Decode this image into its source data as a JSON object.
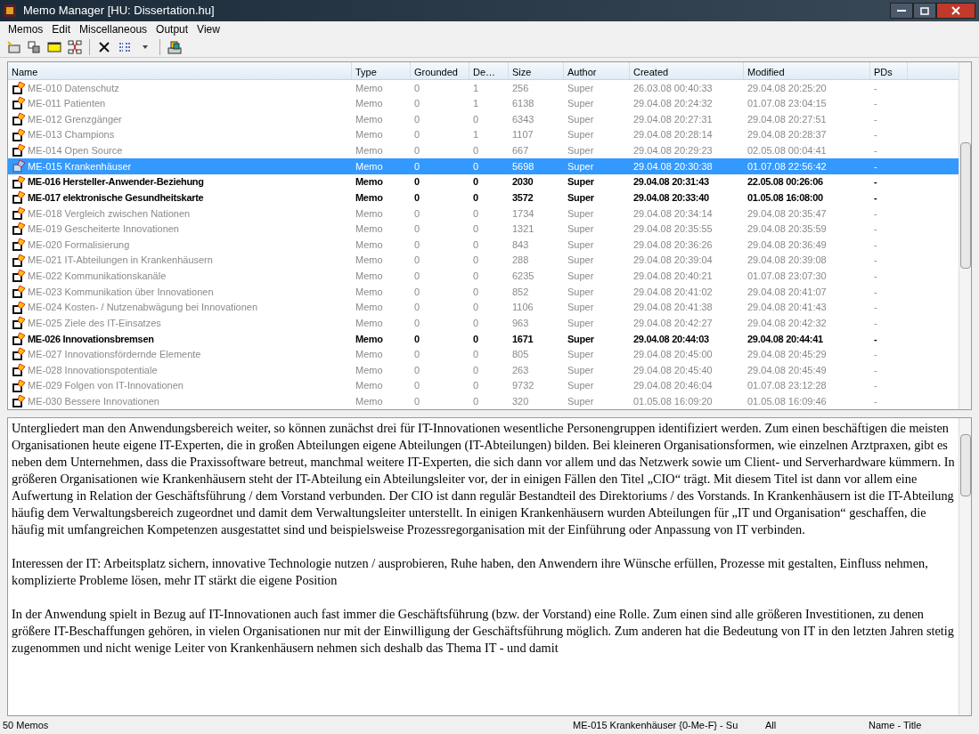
{
  "window": {
    "title": "Memo Manager [HU: Dissertation.hu]"
  },
  "menu": [
    "Memos",
    "Edit",
    "Miscellaneous",
    "Output",
    "View"
  ],
  "table": {
    "columns": [
      "Name",
      "Type",
      "Grounded",
      "De…",
      "Size",
      "Author",
      "Created",
      "Modified",
      "PDs"
    ],
    "rows": [
      {
        "name": "ME-010 Datenschutz",
        "type": "Memo",
        "grounded": "0",
        "de": "1",
        "size": "256",
        "author": "Super",
        "created": "26.03.08 00:40:33",
        "modified": "29.04.08 20:25:20",
        "pds": "-",
        "selected": false,
        "highlighted": false
      },
      {
        "name": "ME-011 Patienten",
        "type": "Memo",
        "grounded": "0",
        "de": "1",
        "size": "6138",
        "author": "Super",
        "created": "29.04.08 20:24:32",
        "modified": "01.07.08 23:04:15",
        "pds": "-",
        "selected": false,
        "highlighted": false
      },
      {
        "name": "ME-012 Grenzgänger",
        "type": "Memo",
        "grounded": "0",
        "de": "0",
        "size": "6343",
        "author": "Super",
        "created": "29.04.08 20:27:31",
        "modified": "29.04.08 20:27:51",
        "pds": "-",
        "selected": false,
        "highlighted": false
      },
      {
        "name": "ME-013 Champions",
        "type": "Memo",
        "grounded": "0",
        "de": "1",
        "size": "1107",
        "author": "Super",
        "created": "29.04.08 20:28:14",
        "modified": "29.04.08 20:28:37",
        "pds": "-",
        "selected": false,
        "highlighted": false
      },
      {
        "name": "ME-014 Open Source",
        "type": "Memo",
        "grounded": "0",
        "de": "0",
        "size": "667",
        "author": "Super",
        "created": "29.04.08 20:29:23",
        "modified": "02.05.08 00:04:41",
        "pds": "-",
        "selected": false,
        "highlighted": false
      },
      {
        "name": "ME-015 Krankenhäuser",
        "type": "Memo",
        "grounded": "0",
        "de": "0",
        "size": "5698",
        "author": "Super",
        "created": "29.04.08 20:30:38",
        "modified": "01.07.08 22:56:42",
        "pds": "-",
        "selected": true,
        "highlighted": false
      },
      {
        "name": "ME-016 Hersteller-Anwender-Beziehung",
        "type": "Memo",
        "grounded": "0",
        "de": "0",
        "size": "2030",
        "author": "Super",
        "created": "29.04.08 20:31:43",
        "modified": "22.05.08 00:26:06",
        "pds": "-",
        "selected": false,
        "highlighted": true
      },
      {
        "name": "ME-017 elektronische Gesundheitskarte",
        "type": "Memo",
        "grounded": "0",
        "de": "0",
        "size": "3572",
        "author": "Super",
        "created": "29.04.08 20:33:40",
        "modified": "01.05.08 16:08:00",
        "pds": "-",
        "selected": false,
        "highlighted": true
      },
      {
        "name": "ME-018 Vergleich zwischen Nationen",
        "type": "Memo",
        "grounded": "0",
        "de": "0",
        "size": "1734",
        "author": "Super",
        "created": "29.04.08 20:34:14",
        "modified": "29.04.08 20:35:47",
        "pds": "-",
        "selected": false,
        "highlighted": false
      },
      {
        "name": "ME-019 Gescheiterte Innovationen",
        "type": "Memo",
        "grounded": "0",
        "de": "0",
        "size": "1321",
        "author": "Super",
        "created": "29.04.08 20:35:55",
        "modified": "29.04.08 20:35:59",
        "pds": "-",
        "selected": false,
        "highlighted": false
      },
      {
        "name": "ME-020 Formalisierung",
        "type": "Memo",
        "grounded": "0",
        "de": "0",
        "size": "843",
        "author": "Super",
        "created": "29.04.08 20:36:26",
        "modified": "29.04.08 20:36:49",
        "pds": "-",
        "selected": false,
        "highlighted": false
      },
      {
        "name": "ME-021 IT-Abteilungen in Krankenhäusern",
        "type": "Memo",
        "grounded": "0",
        "de": "0",
        "size": "288",
        "author": "Super",
        "created": "29.04.08 20:39:04",
        "modified": "29.04.08 20:39:08",
        "pds": "-",
        "selected": false,
        "highlighted": false
      },
      {
        "name": "ME-022 Kommunikationskanäle",
        "type": "Memo",
        "grounded": "0",
        "de": "0",
        "size": "6235",
        "author": "Super",
        "created": "29.04.08 20:40:21",
        "modified": "01.07.08 23:07:30",
        "pds": "-",
        "selected": false,
        "highlighted": false
      },
      {
        "name": "ME-023 Kommunikation über Innovationen",
        "type": "Memo",
        "grounded": "0",
        "de": "0",
        "size": "852",
        "author": "Super",
        "created": "29.04.08 20:41:02",
        "modified": "29.04.08 20:41:07",
        "pds": "-",
        "selected": false,
        "highlighted": false
      },
      {
        "name": "ME-024 Kosten- / Nutzenabwägung bei Innovationen",
        "type": "Memo",
        "grounded": "0",
        "de": "0",
        "size": "1106",
        "author": "Super",
        "created": "29.04.08 20:41:38",
        "modified": "29.04.08 20:41:43",
        "pds": "-",
        "selected": false,
        "highlighted": false
      },
      {
        "name": "ME-025 Ziele des IT-Einsatzes",
        "type": "Memo",
        "grounded": "0",
        "de": "0",
        "size": "963",
        "author": "Super",
        "created": "29.04.08 20:42:27",
        "modified": "29.04.08 20:42:32",
        "pds": "-",
        "selected": false,
        "highlighted": false
      },
      {
        "name": "ME-026 Innovationsbremsen",
        "type": "Memo",
        "grounded": "0",
        "de": "0",
        "size": "1671",
        "author": "Super",
        "created": "29.04.08 20:44:03",
        "modified": "29.04.08 20:44:41",
        "pds": "-",
        "selected": false,
        "highlighted": true
      },
      {
        "name": "ME-027 Innovationsfördernde Elemente",
        "type": "Memo",
        "grounded": "0",
        "de": "0",
        "size": "805",
        "author": "Super",
        "created": "29.04.08 20:45:00",
        "modified": "29.04.08 20:45:29",
        "pds": "-",
        "selected": false,
        "highlighted": false
      },
      {
        "name": "ME-028 Innovationspotentiale",
        "type": "Memo",
        "grounded": "0",
        "de": "0",
        "size": "263",
        "author": "Super",
        "created": "29.04.08 20:45:40",
        "modified": "29.04.08 20:45:49",
        "pds": "-",
        "selected": false,
        "highlighted": false
      },
      {
        "name": "ME-029 Folgen von IT-Innovationen",
        "type": "Memo",
        "grounded": "0",
        "de": "0",
        "size": "9732",
        "author": "Super",
        "created": "29.04.08 20:46:04",
        "modified": "01.07.08 23:12:28",
        "pds": "-",
        "selected": false,
        "highlighted": false
      },
      {
        "name": "ME-030 Bessere Innovationen",
        "type": "Memo",
        "grounded": "0",
        "de": "0",
        "size": "320",
        "author": "Super",
        "created": "01.05.08 16:09:20",
        "modified": "01.05.08 16:09:46",
        "pds": "-",
        "selected": false,
        "highlighted": false
      }
    ]
  },
  "memo_text": [
    "Untergliedert man den Anwendungsbereich weiter, so können zunächst drei für IT-Innovationen wesentliche Personengruppen identifiziert werden. Zum einen beschäftigen die meisten Organisationen heute eigene IT-Experten, die in großen Abteilungen eigene Abteilungen (IT-Abteilungen) bilden. Bei kleineren Organisationsformen, wie einzelnen Arztpraxen, gibt es neben dem Unternehmen, dass die Praxissoftware betreut, manchmal weitere IT-Experten, die sich dann vor allem und das Netzwerk sowie um Client- und Serverhardware kümmern. In größeren Organisationen wie Krankenhäusern steht der IT-Abteilung ein Abteilungsleiter vor, der in einigen Fällen den Titel „CIO“ trägt. Mit diesem Titel ist dann vor allem eine Aufwertung in Relation der Geschäftsführung / dem Vorstand verbunden. Der CIO ist dann regulär Bestandteil des Direktoriums / des Vorstands. In Krankenhäusern ist die IT-Abteilung häufig dem Verwaltungsbereich zugeordnet und damit dem Verwaltungsleiter unterstellt. In einigen Krankenhäusern wurden Abteilungen für „IT und Organisation“ geschaffen, die häufig mit umfangreichen Kompetenzen ausgestattet sind und beispielsweise Prozessregorganisation mit der Einführung oder Anpassung von IT verbinden.",
    "Interessen der IT: Arbeitsplatz sichern, innovative Technologie nutzen / ausprobieren, Ruhe haben, den Anwendern ihre Wünsche erfüllen, Prozesse mit gestalten, Einfluss nehmen, komplizierte Probleme lösen, mehr IT stärkt die eigene Position",
    "In der Anwendung spielt in Bezug auf IT-Innovationen auch fast immer die Geschäftsführung (bzw. der Vorstand) eine Rolle. Zum einen sind alle größeren Investitionen, zu denen größere IT-Beschaffungen gehören, in vielen Organisationen nur mit der Einwilligung der Geschäftsführung möglich. Zum anderen hat die Bedeutung von IT in den letzten Jahren stetig zugenommen und nicht wenige Leiter von Krankenhäusern nehmen sich deshalb das Thema IT - und damit"
  ],
  "status_bar": [
    "50 Memos",
    "ME-015 Krankenhäuser {0-Me-F} - Su",
    "All",
    "Name - Title"
  ]
}
